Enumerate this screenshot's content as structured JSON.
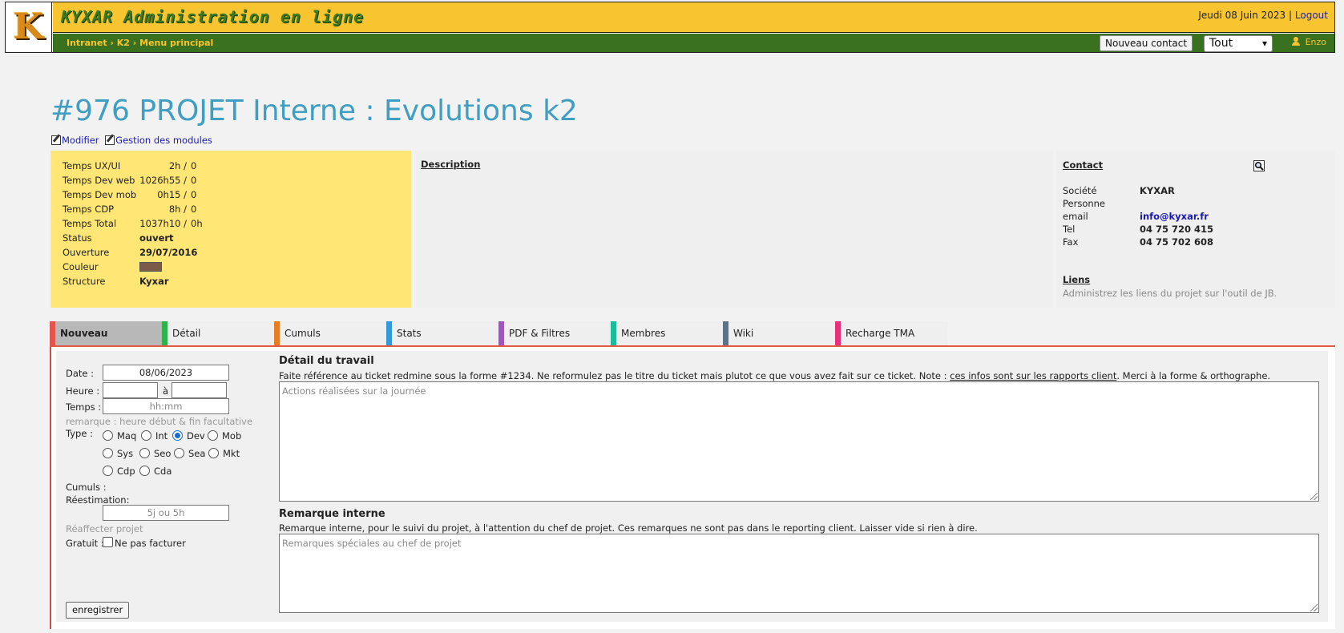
{
  "header": {
    "logo_letter": "K",
    "app_title": "KYXAR Administration en ligne",
    "date": "Jeudi 08 Juin 2023",
    "separator": "|",
    "logout_label": "Logout",
    "breadcrumb": "Intranet › K2 › Menu principal",
    "new_contact_label": "Nouveau contact",
    "filter_value": "Tout",
    "user_name": "Enzo"
  },
  "project": {
    "title": "#976 PROJET Interne : Evolutions k2",
    "edit_label": "Modifier",
    "modules_label": "Gestion des modules"
  },
  "info": {
    "time_rows": [
      {
        "label": "Temps UX/UI",
        "value": "2h /",
        "spent": "0"
      },
      {
        "label": "Temps Dev web",
        "value": "1026h55 /",
        "spent": "0"
      },
      {
        "label": "Temps Dev mob",
        "value": "0h15 /",
        "spent": "0"
      },
      {
        "label": "Temps CDP",
        "value": "8h /",
        "spent": "0"
      },
      {
        "label": "Temps Total",
        "value": "1037h10 /",
        "spent": "0h"
      }
    ],
    "status_label": "Status",
    "status_value": "ouvert",
    "opening_label": "Ouverture",
    "opening_value": "29/07/2016",
    "color_label": "Couleur",
    "color_value": "#7a5a48",
    "structure_label": "Structure",
    "structure_value": "Kyxar"
  },
  "description": {
    "title": "Description"
  },
  "contact": {
    "title": "Contact",
    "rows": [
      {
        "label": "Société",
        "value": "KYXAR"
      },
      {
        "label": "Personne",
        "value": ""
      },
      {
        "label": "email",
        "value": "info@kyxar.fr"
      },
      {
        "label": "Tel",
        "value": "04 75 720 415"
      },
      {
        "label": "Fax",
        "value": "04 75 702 608"
      }
    ],
    "links_title": "Liens",
    "links_text": "Administrez les liens du projet sur l'outil de JB."
  },
  "tabs": [
    {
      "label": "Nouveau",
      "color": "#e2564d"
    },
    {
      "label": "Détail",
      "color": "#2db34a"
    },
    {
      "label": "Cumuls",
      "color": "#e67e22"
    },
    {
      "label": "Stats",
      "color": "#3498db"
    },
    {
      "label": "PDF & Filtres",
      "color": "#9b59b6"
    },
    {
      "label": "Membres",
      "color": "#1abc9c"
    },
    {
      "label": "Wiki",
      "color": "#5d7386"
    },
    {
      "label": "Recharge TMA",
      "color": "#e8307a"
    }
  ],
  "form": {
    "date_label": "Date :",
    "date_value": "08/06/2023",
    "hour_label": "Heure :",
    "hour_sep": "à",
    "time_label": "Temps :",
    "time_placeholder": "hh:mm",
    "remark": "remarque : heure début & fin facultative",
    "type_label": "Type :",
    "types": [
      "Maq",
      "Int",
      "Dev",
      "Mob",
      "Sys",
      "Seo",
      "Sea",
      "Mkt",
      "Cdp",
      "Cda"
    ],
    "selected_type": "Dev",
    "cumuls_label": "Cumuls :",
    "reestimation_label": "Réestimation:",
    "reestimation_placeholder": "5j ou 5h",
    "reassign_label": "Réaffecter projet",
    "free_label": "Gratuit :",
    "no_bill_label": "Ne pas facturer",
    "save_label": "enregistrer"
  },
  "work": {
    "title": "Détail du travail",
    "desc_before": "Faite référence au ticket redmine sous la forme #1234. Ne reformulez pas le titre du ticket mais plutot ce que vous avez fait sur ce ticket. Note : ",
    "desc_underlined": "ces infos sont sur les rapports client",
    "desc_after": ". Merci à la forme & orthographe.",
    "placeholder": "Actions réalisées sur la journée"
  },
  "internal": {
    "title": "Remarque interne",
    "desc": "Remarque interne, pour le suivi du projet, à l'attention du chef de projet. Ces remarques ne sont pas dans le reporting client. Laisser vide si rien à dire.",
    "placeholder": "Remarques spéciales au chef de projet"
  }
}
